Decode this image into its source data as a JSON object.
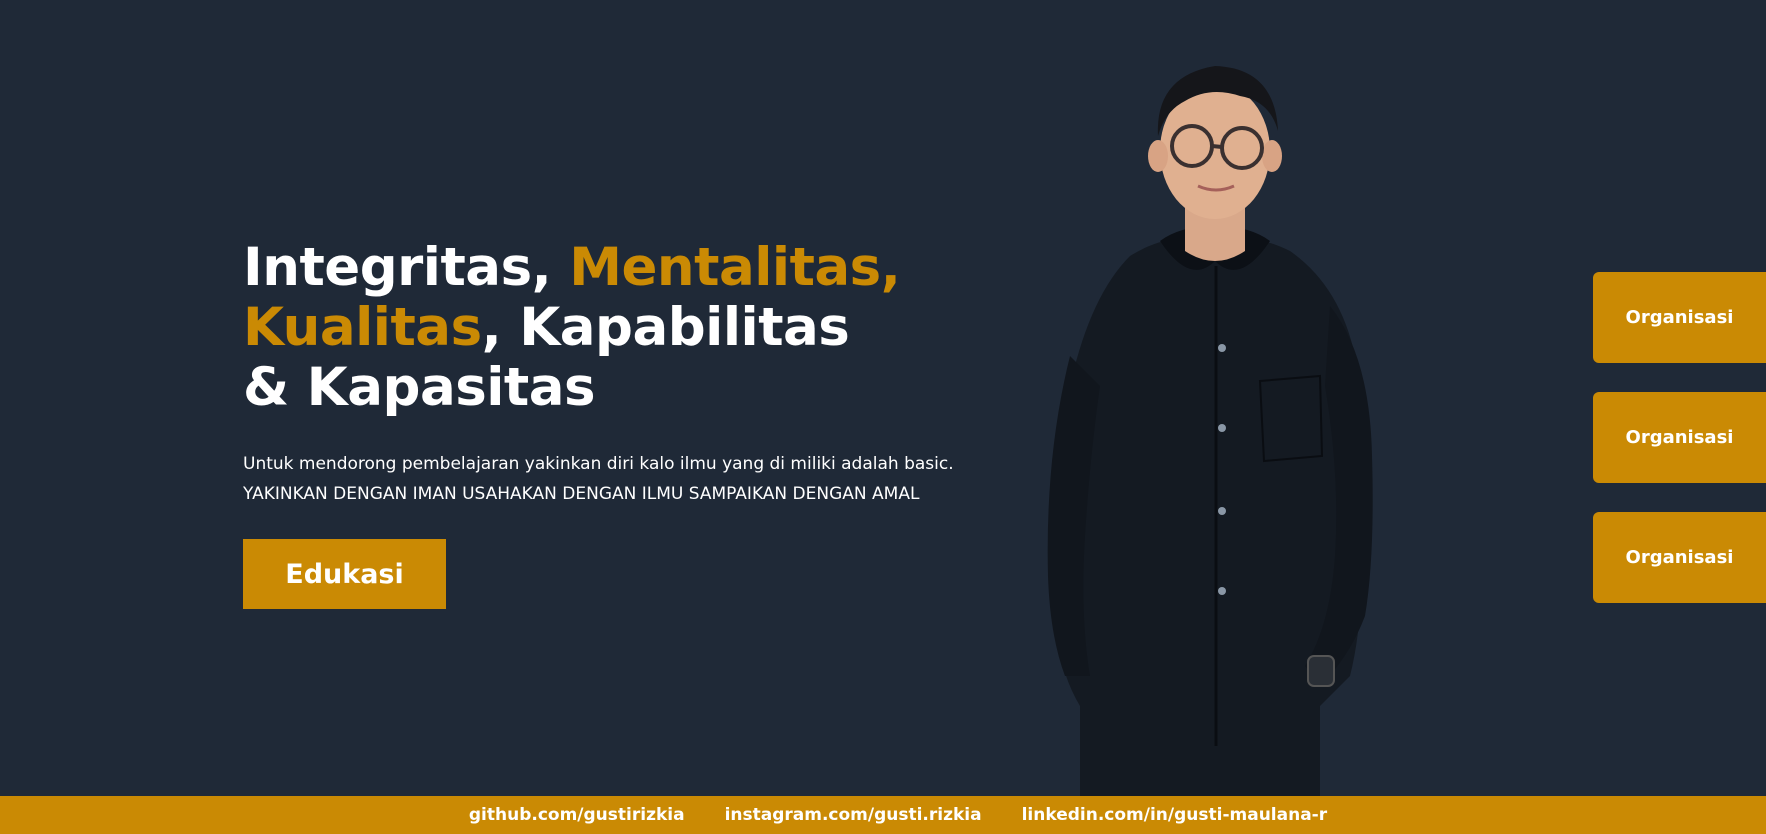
{
  "hero": {
    "headline": {
      "part1": "Integritas, ",
      "part2_accent": "Mentalitas,",
      "part3_accent": "Kualitas",
      "part4": ", Kapabilitas",
      "part5": "& Kapasitas"
    },
    "subtext_line1": "Untuk mendorong pembelajaran yakinkan diri kalo ilmu yang di miliki adalah basic.",
    "subtext_line2": "YAKINKAN DENGAN IMAN USAHAKAN DENGAN ILMU SAMPAIKAN DENGAN AMAL",
    "cta_label": "Edukasi"
  },
  "side_tabs": [
    {
      "label": "Organisasi"
    },
    {
      "label": "Organisasi"
    },
    {
      "label": "Organisasi"
    }
  ],
  "footer": {
    "links": [
      {
        "label": "github.com/gustirizkia"
      },
      {
        "label": "instagram.com/gusti.rizkia"
      },
      {
        "label": "linkedin.com/in/gusti-maulana-r"
      }
    ]
  },
  "colors": {
    "background": "#1f2937",
    "accent": "#ca8a04",
    "text": "#ffffff"
  },
  "icons": {
    "portrait": "person-portrait-photo"
  }
}
